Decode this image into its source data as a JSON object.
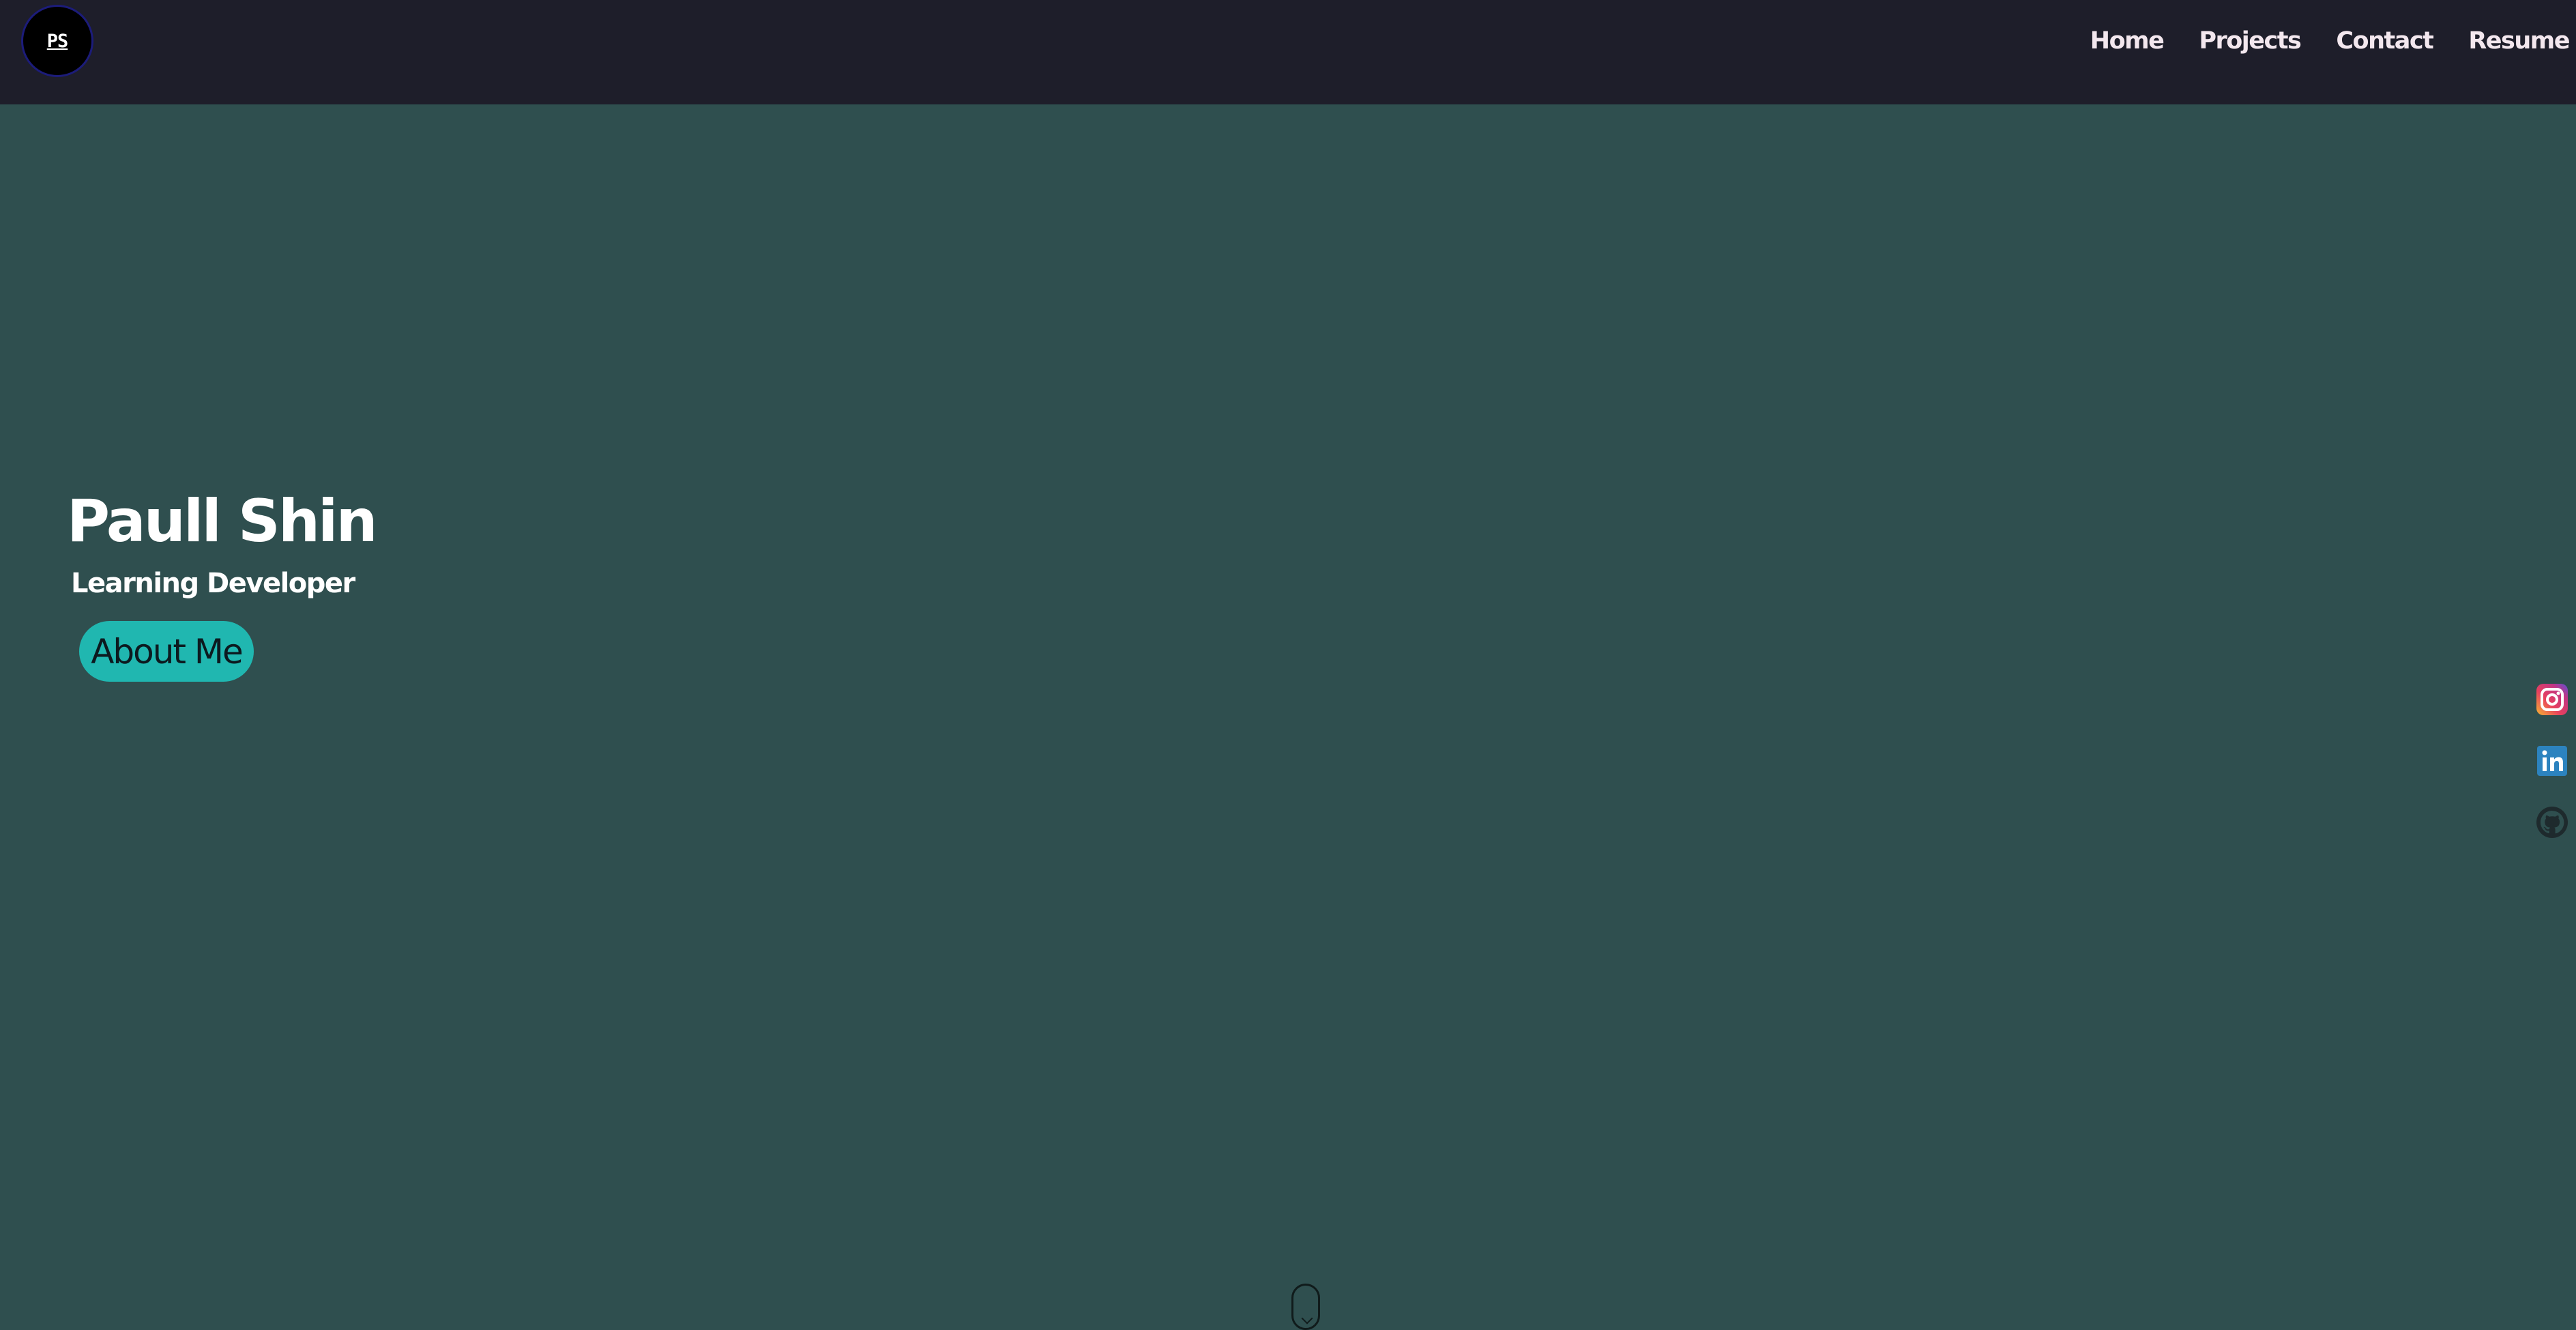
{
  "header": {
    "logo_text": "PS",
    "nav": [
      {
        "label": "Home"
      },
      {
        "label": "Projects"
      },
      {
        "label": "Contact"
      },
      {
        "label": "Resume"
      }
    ]
  },
  "hero": {
    "name": "Paull Shin",
    "subtitle": "Learning Developer",
    "button_label": "About Me"
  },
  "social": [
    {
      "icon": "instagram-icon"
    },
    {
      "icon": "linkedin-icon"
    },
    {
      "icon": "github-icon"
    }
  ],
  "colors": {
    "header_bg": "#1e1e2a",
    "page_bg": "#2f4f4f",
    "accent": "#20b7b0"
  }
}
